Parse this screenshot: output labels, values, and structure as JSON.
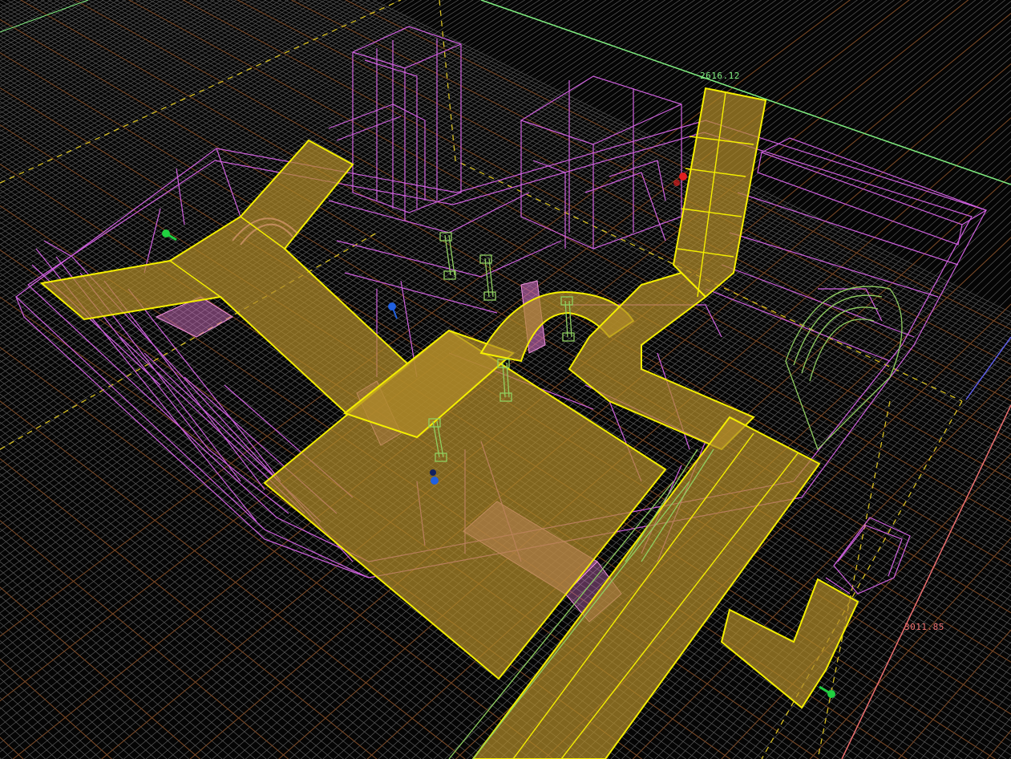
{
  "viewport": {
    "mode": "perspective-wireframe",
    "dimension_x": "2616.12",
    "dimension_y": "3011.85"
  },
  "colors": {
    "background": "#050505",
    "grid_minor": "#5a5a5a",
    "grid_major": "#7a4a28",
    "wire_geometry": "#d060e0",
    "selection_outline": "#f5f000",
    "selection_fill": "#b08a2a",
    "model_wire": "#90d060",
    "bbox_edge_x": "#80f080",
    "bbox_edge_y": "#f07070",
    "bbox_edge_z": "#6060f0",
    "entity_green": "#20d040",
    "entity_red": "#e02020",
    "entity_blue": "#2060e0"
  },
  "entities": [
    {
      "name": "player-start-entity",
      "color": "green"
    },
    {
      "name": "light-entity-red",
      "color": "red"
    },
    {
      "name": "light-entity-blue-1",
      "color": "blue"
    },
    {
      "name": "light-entity-blue-2",
      "color": "blue"
    },
    {
      "name": "player-start-entity-2",
      "color": "green"
    }
  ]
}
